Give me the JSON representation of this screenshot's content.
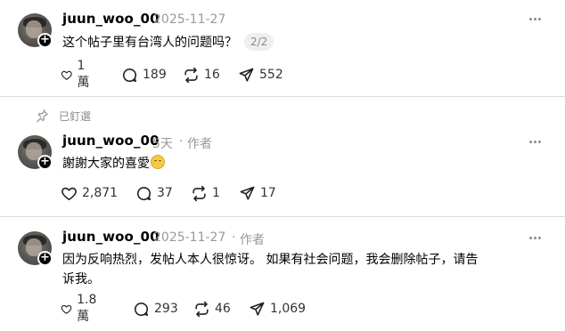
{
  "posts": [
    {
      "username": "juun_woo_00",
      "timestamp": "2025-11-27",
      "author_tag": "",
      "text": "这个帖子里有台湾人的问题吗？",
      "pager": "2/2",
      "likes": "1 萬",
      "comments": "189",
      "reposts": "16",
      "shares": "552"
    },
    {
      "username": "juun_woo_00",
      "timestamp": "5天",
      "author_tag": "作者",
      "text": "謝謝大家的喜愛",
      "likes": "2,871",
      "comments": "37",
      "reposts": "1",
      "shares": "17"
    },
    {
      "username": "juun_woo_00",
      "timestamp": "2025-11-27",
      "author_tag": "作者",
      "text_line1": "因为反响热烈，发帖人本人很惊讶。 如果有社会问题，我会删除帖子，请告",
      "text_line2": "诉我。",
      "likes": "1.8 萬",
      "comments": "293",
      "reposts": "46",
      "shares": "1,069"
    }
  ],
  "pinned_label": "已釘選",
  "separator": "·",
  "icons": [
    "heart-icon",
    "comment-icon",
    "repost-icon",
    "share-icon",
    "more-icon",
    "pin-icon",
    "follow-plus-icon",
    "smile-emoji-icon"
  ]
}
